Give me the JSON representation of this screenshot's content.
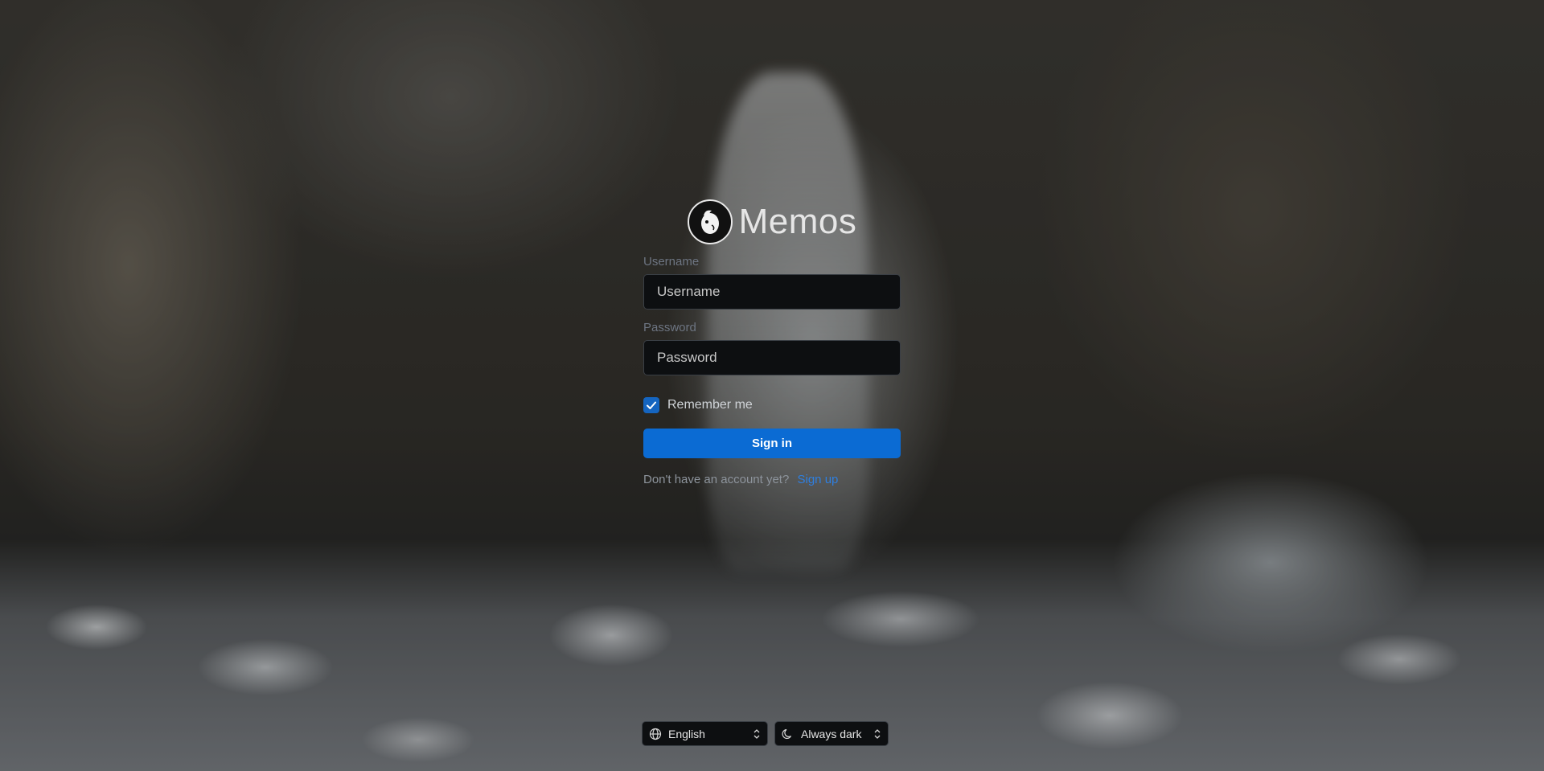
{
  "app": {
    "name": "Memos"
  },
  "form": {
    "username_label": "Username",
    "username_placeholder": "Username",
    "password_label": "Password",
    "password_placeholder": "Password",
    "remember_label": "Remember me",
    "remember_checked": true,
    "signin_label": "Sign in",
    "signup_prompt": "Don't have an account yet?",
    "signup_link": "Sign up"
  },
  "footer": {
    "language": {
      "icon": "globe-icon",
      "value": "English"
    },
    "theme": {
      "icon": "moon-icon",
      "value": "Always dark"
    }
  },
  "colors": {
    "accent": "#0b6bd3",
    "link": "#2e7fe0",
    "input_bg": "#0d0f11"
  }
}
